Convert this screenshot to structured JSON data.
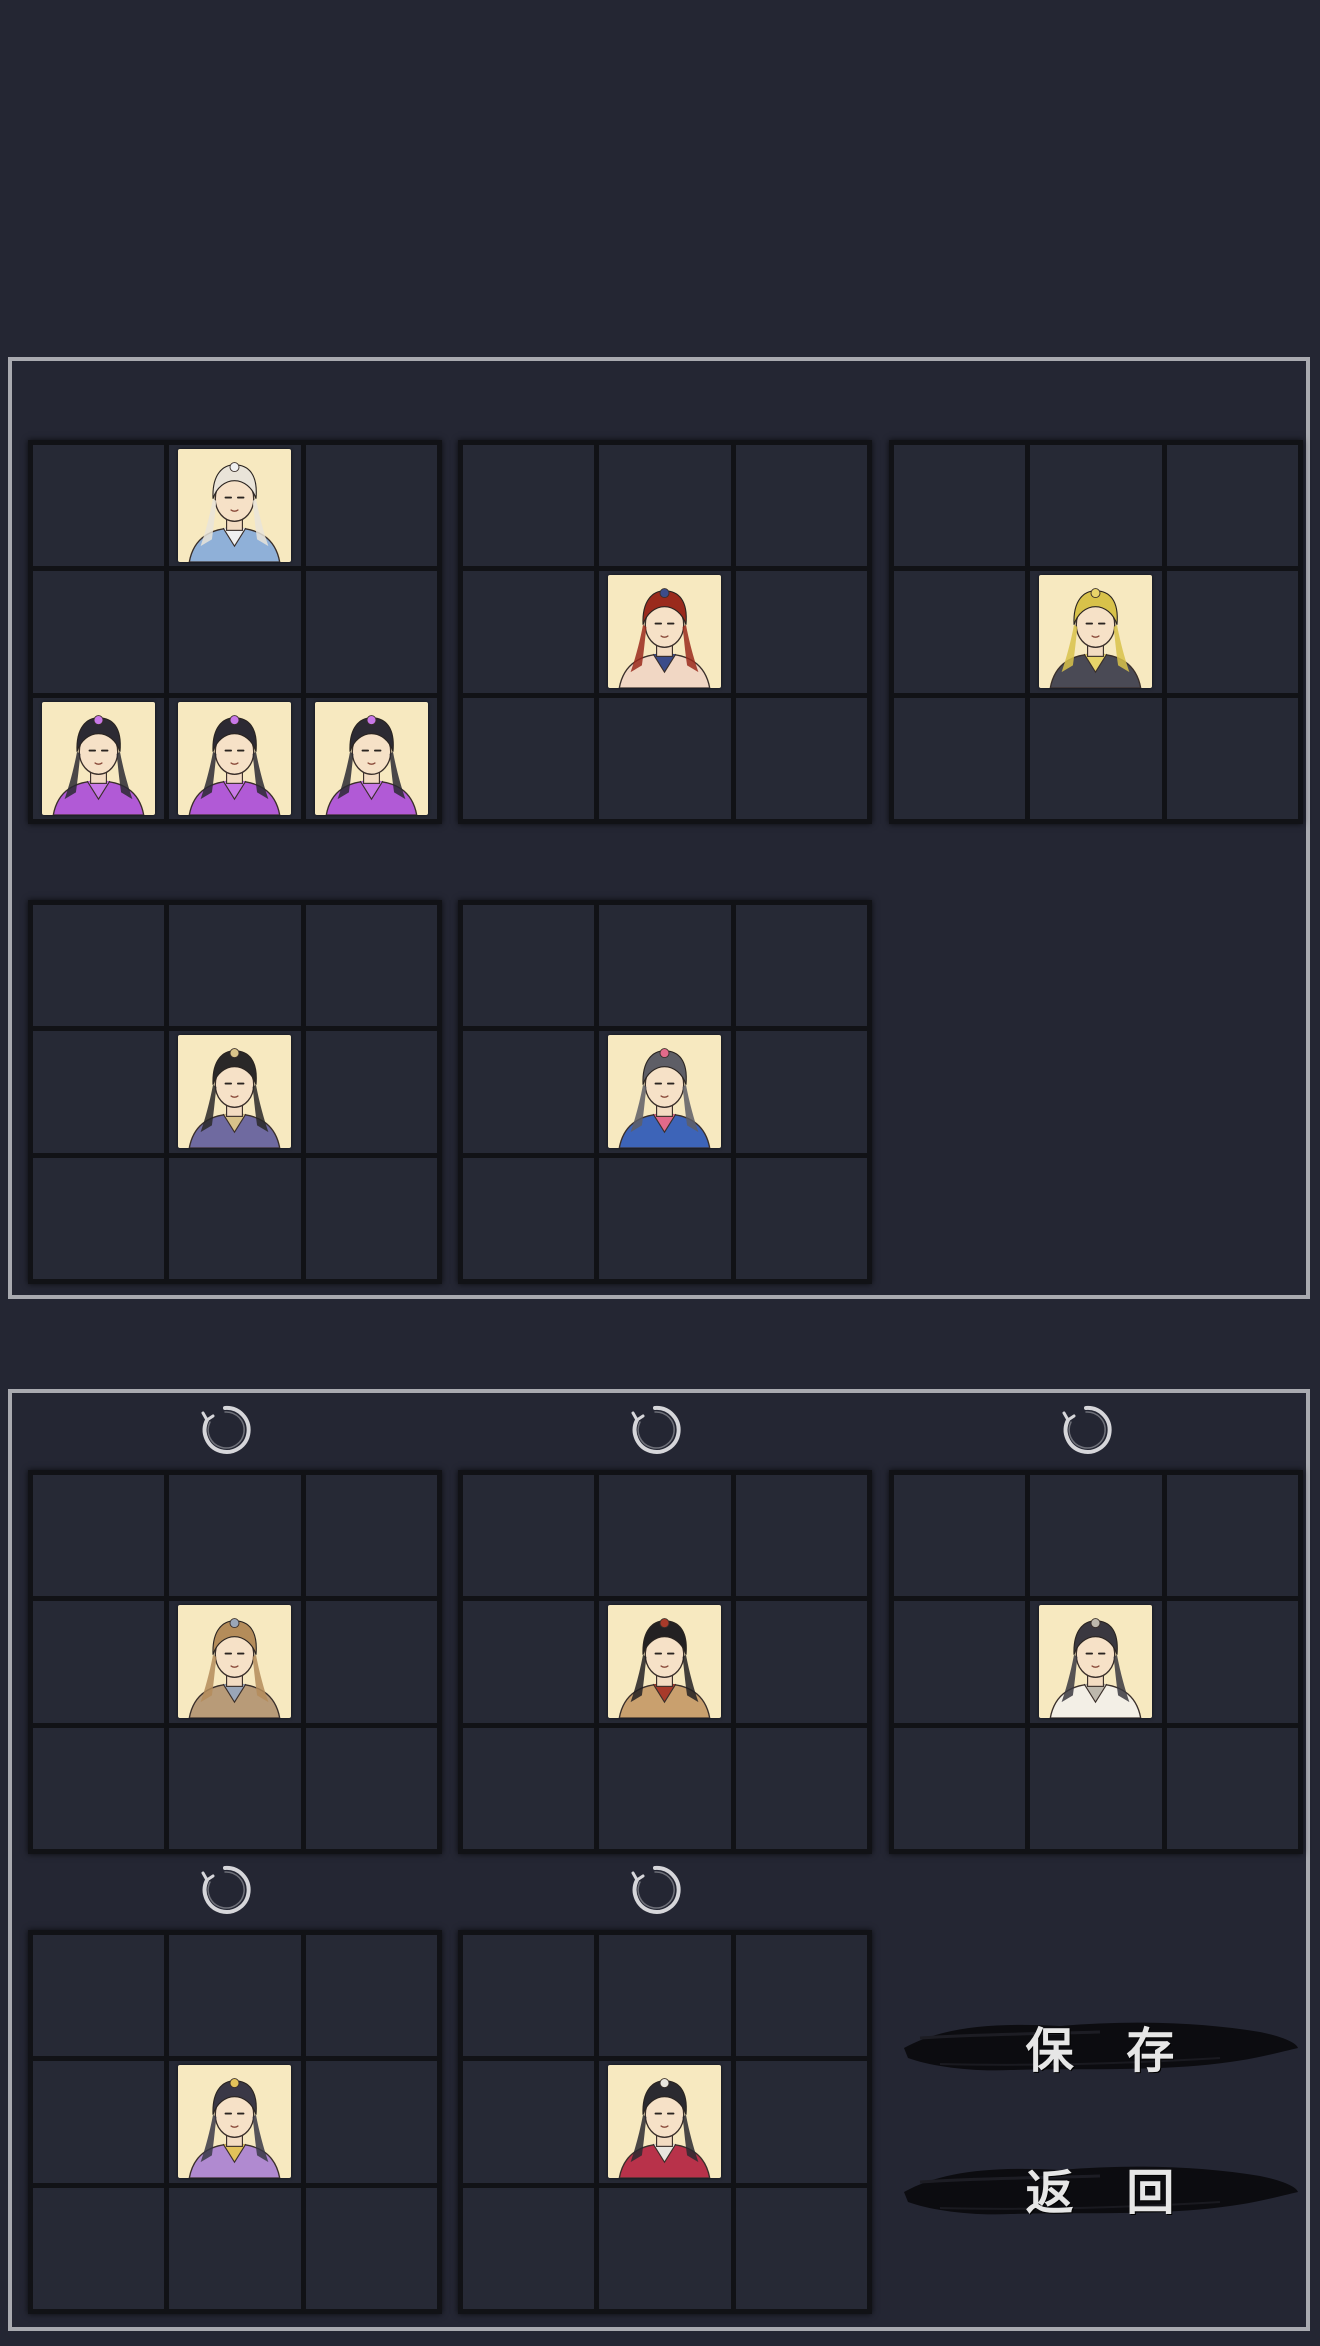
{
  "formation_top": {
    "boards": [
      {
        "id": "board-top-1",
        "heroes": [
          {
            "cell": 1,
            "name": "fan-scholar",
            "bg": "#f7e9c0",
            "hair": "#e9e4d9",
            "robe": "#8fb0d8",
            "accent": "#f0f0f0"
          },
          {
            "cell": 6,
            "name": "veiled-sorceress",
            "bg": "#f7e9c0",
            "hair": "#2c2a33",
            "robe": "#b15ad6",
            "accent": "#c878e8"
          },
          {
            "cell": 7,
            "name": "veiled-sorceress",
            "bg": "#f7e9c0",
            "hair": "#2c2a33",
            "robe": "#b15ad6",
            "accent": "#c878e8"
          },
          {
            "cell": 8,
            "name": "veiled-sorceress",
            "bg": "#f7e9c0",
            "hair": "#2c2a33",
            "robe": "#b15ad6",
            "accent": "#c878e8"
          }
        ]
      },
      {
        "id": "board-top-2",
        "heroes": [
          {
            "cell": 4,
            "name": "horned-warrior",
            "bg": "#f7e9c0",
            "hair": "#9a2a1c",
            "robe": "#f1d7c4",
            "accent": "#3b4c8a"
          }
        ]
      },
      {
        "id": "board-top-3",
        "heroes": [
          {
            "cell": 4,
            "name": "bearded-elder",
            "bg": "#f7e9c0",
            "hair": "#d8c24a",
            "robe": "#4a4a55",
            "accent": "#e8d46a"
          }
        ]
      },
      {
        "id": "board-top-4",
        "heroes": [
          {
            "cell": 4,
            "name": "eyepatch-swordsman",
            "bg": "#f7e9c0",
            "hair": "#2a2828",
            "robe": "#6f6aa0",
            "accent": "#d9c38a"
          }
        ]
      },
      {
        "id": "board-top-5",
        "heroes": [
          {
            "cell": 4,
            "name": "silver-haired-swordsman",
            "bg": "#f7e9c0",
            "hair": "#5e5e66",
            "robe": "#3d64b8",
            "accent": "#e26a8a"
          }
        ]
      }
    ]
  },
  "formation_bottom": {
    "boards": [
      {
        "id": "board-bottom-1",
        "heroes": [
          {
            "cell": 4,
            "name": "fur-hat-blademaster",
            "bg": "#f7e9c0",
            "hair": "#b48c5a",
            "robe": "#b89b78",
            "accent": "#9aa6b8"
          }
        ]
      },
      {
        "id": "board-bottom-2",
        "heroes": [
          {
            "cell": 4,
            "name": "topknot-brawler",
            "bg": "#f7e9c0",
            "hair": "#232123",
            "robe": "#c9a06e",
            "accent": "#a83a2a"
          }
        ]
      },
      {
        "id": "board-bottom-3",
        "heroes": [
          {
            "cell": 4,
            "name": "white-robed-swordsman",
            "bg": "#f7e9c0",
            "hair": "#3a3840",
            "robe": "#f3efe6",
            "accent": "#bdb8ad"
          }
        ]
      },
      {
        "id": "board-bottom-4",
        "heroes": [
          {
            "cell": 4,
            "name": "crowned-lady",
            "bg": "#f7e9c0",
            "hair": "#3a3846",
            "robe": "#b08ad0",
            "accent": "#e3c25a"
          }
        ]
      },
      {
        "id": "board-bottom-5",
        "heroes": [
          {
            "cell": 4,
            "name": "ponytail-swordsman",
            "bg": "#f7e9c0",
            "hair": "#2b2a30",
            "robe": "#b8324a",
            "accent": "#e9e6df"
          }
        ]
      }
    ]
  },
  "buttons": {
    "save_label": "保 存",
    "back_label": "返 回"
  },
  "icons": {
    "swap": "refresh-circle-icon",
    "ink_stroke": "ink-brush-icon"
  },
  "colors": {
    "background": "#242633",
    "panel_border": "#a9aab0",
    "cell": "#262935",
    "grid_line": "#111216",
    "portrait_bg": "#f7e9c0"
  }
}
